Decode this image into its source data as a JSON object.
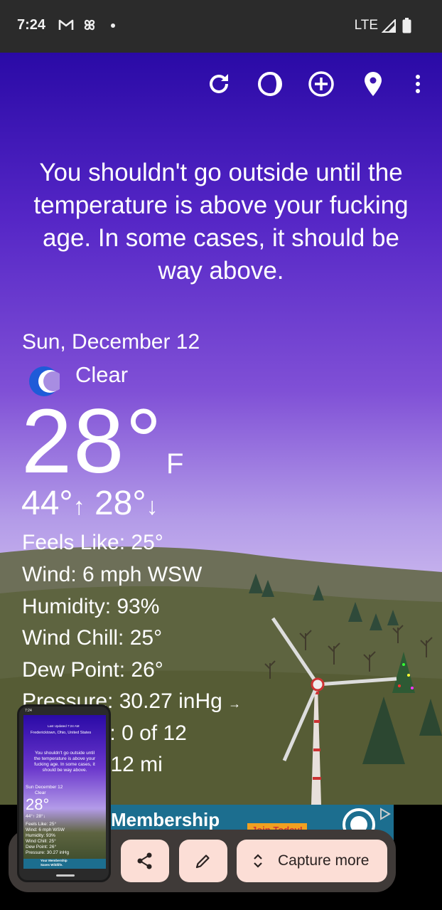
{
  "status_bar": {
    "time": "7:24",
    "network": "LTE",
    "icons": [
      "gmail-icon",
      "pinwheel-icon",
      "notification-dot-icon",
      "signal-icon",
      "battery-icon"
    ]
  },
  "toolbar": {
    "icons": [
      "refresh-icon",
      "moon-phase-icon",
      "add-location-icon",
      "location-pin-icon",
      "overflow-menu-icon"
    ]
  },
  "quote": "You shouldn't go outside until the temperature is above your fucking age. In some cases, it should be way above.",
  "weather": {
    "date": "Sun, December 12",
    "condition": "Clear",
    "condition_icon": "crescent-moon-icon",
    "temperature": "28°",
    "unit": "F",
    "high": "44°",
    "low": "28°",
    "details": [
      "Feels Like:  25°",
      "Wind:  6 mph WSW",
      "Humidity:  93%",
      "Wind Chill:  25°",
      "Dew Point:  26°",
      "Pressure:  30.27 inHg",
      "UV Index:  0 of 12",
      "Visibility:  12 mi"
    ]
  },
  "ad": {
    "text": "Membership",
    "button": "Join Today!"
  },
  "capture_toolbar": {
    "capture_more_label": "Capture more"
  },
  "thumbnail": {
    "updated": "Last Updated 7:24 AM",
    "location": "Fredericktown, Ohio, United States",
    "quote": [
      "You shouldn't go outside until",
      "the temperature is above your",
      "fucking age. In some cases, it",
      "should be way above."
    ],
    "date": "Sun December 12",
    "condition": "Clear",
    "temperature": "28°",
    "hilo": "44°↑ 28°↓",
    "details": [
      "Feels Like:  25°",
      "Wind:  6 mph WSW",
      "Humidity:  93%",
      "Wind Chill:  25°",
      "Dew Point:  26°",
      "Pressure:  30.27 inHg"
    ],
    "ad_line1": "Your Membership",
    "ad_line2": "Saves Wildlife."
  },
  "colors": {
    "sky_top": "#2a0aa6",
    "sky_mid": "#8050d6",
    "sky_low": "#cbb8ee",
    "hill": "#5e6440",
    "capture_button": "#fcded6",
    "capture_panel": "#3f3a38"
  }
}
